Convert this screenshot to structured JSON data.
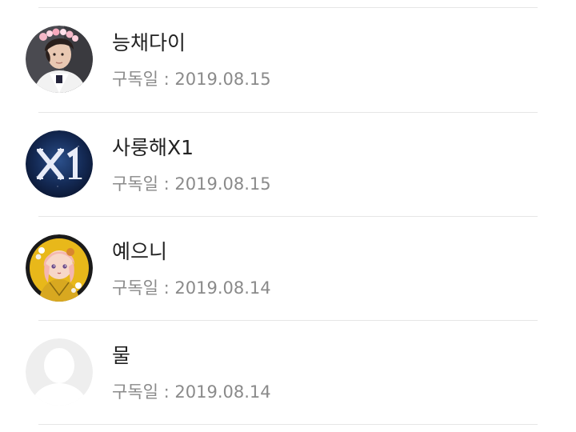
{
  "subscribers": [
    {
      "name": "능채다이",
      "date_text": "구독일 : 2019.08.15",
      "avatar": "photo-person-flower-crown"
    },
    {
      "name": "사룽해X1",
      "date_text": "구독일 : 2019.08.15",
      "avatar": "x1-logo"
    },
    {
      "name": "예으니",
      "date_text": "구독일 : 2019.08.14",
      "avatar": "anime-girl-drawing"
    },
    {
      "name": "물",
      "date_text": "구독일 : 2019.08.14",
      "avatar": "default-profile-silhouette"
    }
  ],
  "colors": {
    "name_text": "#222222",
    "date_text": "#8a8a8a",
    "divider": "#e6e6e6",
    "x1_background": "#0d1b3d",
    "avatar3_ring": "#1a1a1a",
    "avatar3_background": "#e8b81a",
    "default_avatar": "#eeeeee"
  }
}
